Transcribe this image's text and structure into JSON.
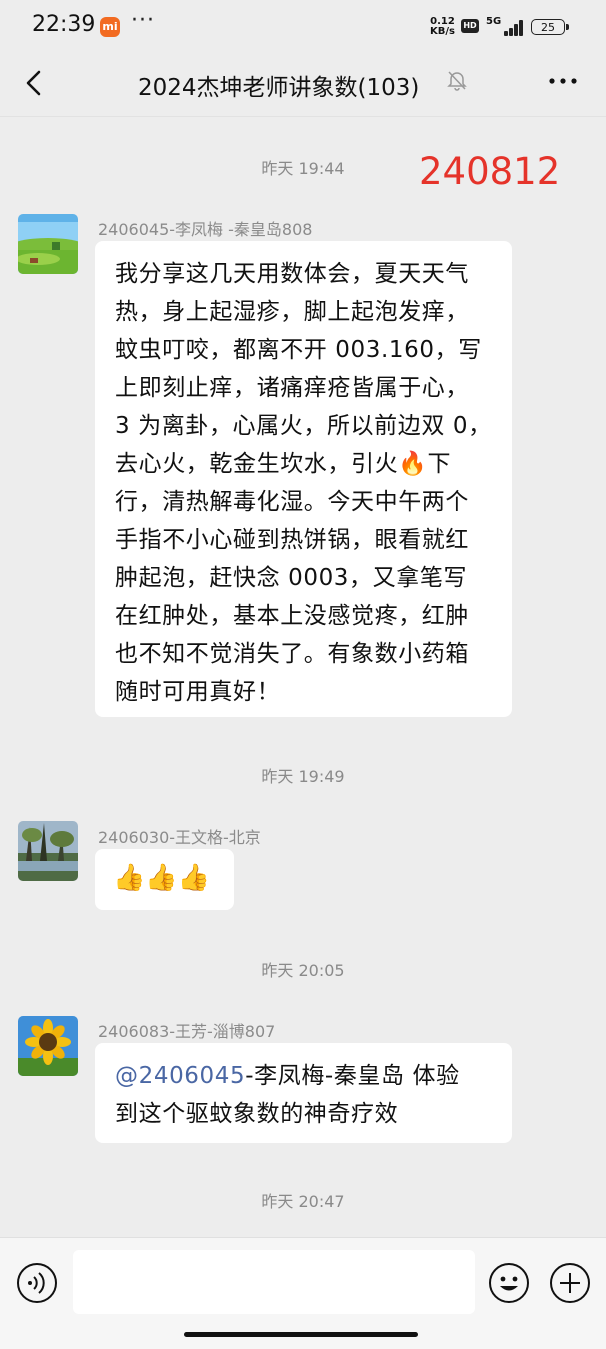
{
  "status_bar": {
    "time": "22:39",
    "mi_label": "mi",
    "more": "···",
    "speed_value": "0.12",
    "speed_unit": "KB/s",
    "hd": "HD",
    "network": "5G",
    "battery": "25"
  },
  "header": {
    "title": "2024杰坤老师讲象数(103)",
    "back_icon": "chevron-left-icon",
    "mute_icon": "bell-off-icon",
    "more_icon": "more-dots-icon"
  },
  "overlay_stamp": "240812",
  "messages": [
    {
      "time": "昨天 19:44",
      "sender": "2406045-李凤梅 -秦皇岛808",
      "avatar": "landscape-cow-avatar",
      "lines": [
        "我分享这几天用数体会，夏天天气",
        "热，身上起湿疹，脚上起泡发痒，",
        "蚊虫叮咬，都离不开 003.160，写",
        "上即刻止痒，诸痛痒疮皆属于心，",
        "3 为离卦，心属火，所以前边双 0，",
        "去心火，乾金生坎水，引火🔥下",
        "行，清热解毒化湿。今天中午两个",
        "手指不小心碰到热饼锅，眼看就红",
        "肿起泡，赶快念 0003，又拿笔写",
        "在红肿处，基本上没感觉疼，红肿",
        "也不知不觉消失了。有象数小药箱",
        "随时可用真好！"
      ]
    },
    {
      "time": "昨天 19:49",
      "sender": "2406030-王文格-北京",
      "avatar": "lake-trees-avatar",
      "content": "👍👍👍"
    },
    {
      "time": "昨天 20:05",
      "sender": "2406083-王芳-淄博807",
      "avatar": "sunflower-avatar",
      "mention": "@2406045",
      "line1_rest": "-李凤梅-秦皇岛  体验",
      "line2": "到这个驱蚊象数的神奇疗效"
    },
    {
      "time": "昨天 20:47"
    }
  ],
  "input_bar": {
    "voice_icon": "voice-icon",
    "emoji_icon": "smiley-icon",
    "plus_icon": "plus-icon",
    "placeholder": ""
  }
}
